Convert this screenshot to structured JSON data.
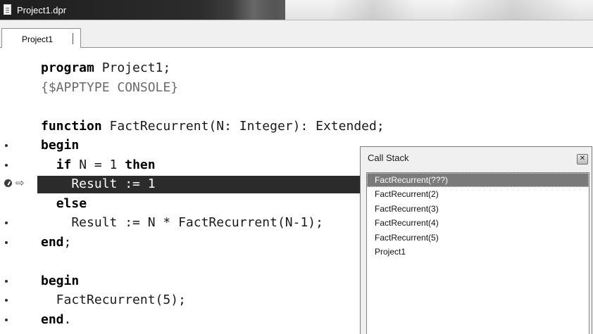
{
  "window": {
    "title": "Project1.dpr",
    "icon": "document-icon"
  },
  "tabs": [
    {
      "label": "Project1",
      "active": true
    }
  ],
  "editor": {
    "lines": [
      {
        "gutter": "",
        "tokens": [
          {
            "t": "kw",
            "v": "program"
          },
          {
            "t": "plain",
            "v": " Project1;"
          }
        ]
      },
      {
        "gutter": "",
        "tokens": [
          {
            "t": "comment",
            "v": "{$APPTYPE CONSOLE}"
          }
        ]
      },
      {
        "gutter": "",
        "tokens": []
      },
      {
        "gutter": "",
        "tokens": [
          {
            "t": "kw",
            "v": "function"
          },
          {
            "t": "plain",
            "v": " FactRecurrent(N: Integer): Extended;"
          }
        ]
      },
      {
        "gutter": "dot",
        "tokens": [
          {
            "t": "kw",
            "v": "begin"
          }
        ]
      },
      {
        "gutter": "dot",
        "tokens": [
          {
            "t": "plain",
            "v": "  "
          },
          {
            "t": "kw",
            "v": "if"
          },
          {
            "t": "plain",
            "v": " N = 1 "
          },
          {
            "t": "kw",
            "v": "then"
          }
        ]
      },
      {
        "gutter": "exec",
        "current": true,
        "tokens": [
          {
            "t": "plain",
            "v": "    Result := 1"
          }
        ]
      },
      {
        "gutter": "",
        "tokens": [
          {
            "t": "plain",
            "v": "  "
          },
          {
            "t": "kw",
            "v": "else"
          }
        ]
      },
      {
        "gutter": "dot",
        "tokens": [
          {
            "t": "plain",
            "v": "    Result := N * FactRecurrent(N-1);"
          }
        ]
      },
      {
        "gutter": "dot",
        "tokens": [
          {
            "t": "kw",
            "v": "end"
          },
          {
            "t": "plain",
            "v": ";"
          }
        ]
      },
      {
        "gutter": "",
        "tokens": []
      },
      {
        "gutter": "dot",
        "tokens": [
          {
            "t": "kw",
            "v": "begin"
          }
        ]
      },
      {
        "gutter": "dot",
        "tokens": [
          {
            "t": "plain",
            "v": "  FactRecurrent(5);"
          }
        ]
      },
      {
        "gutter": "dot",
        "tokens": [
          {
            "t": "kw",
            "v": "end"
          },
          {
            "t": "plain",
            "v": "."
          }
        ]
      }
    ]
  },
  "call_stack": {
    "title": "Call Stack",
    "close_icon": "close-icon",
    "items": [
      {
        "label": "FactRecurrent(???)",
        "selected": true
      },
      {
        "label": "FactRecurrent(2)",
        "selected": false
      },
      {
        "label": "FactRecurrent(3)",
        "selected": false
      },
      {
        "label": "FactRecurrent(4)",
        "selected": false
      },
      {
        "label": "FactRecurrent(5)",
        "selected": false
      },
      {
        "label": "Project1",
        "selected": false
      }
    ]
  },
  "colors": {
    "titlebar_active": "#1e1e1e",
    "current_line": "#2b2b2b",
    "selection": "#7a7a7a"
  }
}
